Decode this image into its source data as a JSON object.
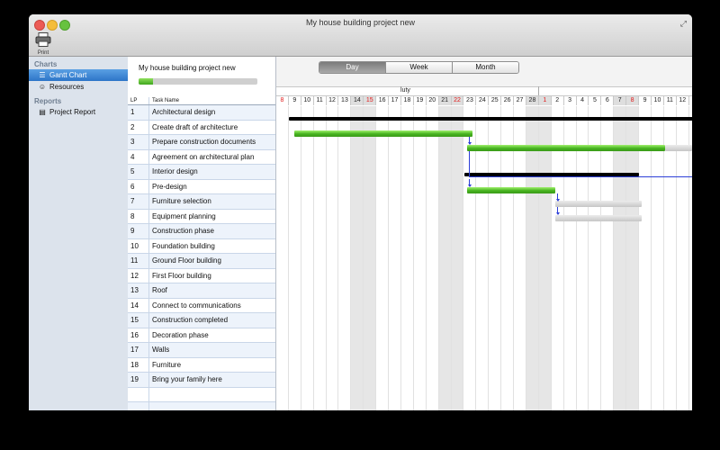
{
  "window": {
    "title": "My house building project new"
  },
  "toolbar": {
    "print_label": "Print"
  },
  "sidebar": {
    "charts_header": "Charts",
    "charts_items": [
      {
        "label": "Gantt Chart",
        "icon": "gantt-icon",
        "selected": true
      },
      {
        "label": "Resources",
        "icon": "people-icon",
        "selected": false
      }
    ],
    "reports_header": "Reports",
    "reports_items": [
      {
        "label": "Project Report",
        "icon": "report-icon",
        "selected": false
      }
    ]
  },
  "project": {
    "name": "My house building project new",
    "progress": 0.12
  },
  "task_table": {
    "col_lp": "LP",
    "col_name": "Task Name",
    "rows": [
      {
        "lp": "1",
        "name": "Architectural design"
      },
      {
        "lp": "2",
        "name": "Create draft of architecture"
      },
      {
        "lp": "3",
        "name": "Prepare construction documents"
      },
      {
        "lp": "4",
        "name": "Agreement on architectural plan"
      },
      {
        "lp": "5",
        "name": "Interior design"
      },
      {
        "lp": "6",
        "name": "Pre-design"
      },
      {
        "lp": "7",
        "name": "Furniture selection"
      },
      {
        "lp": "8",
        "name": "Equipment planning"
      },
      {
        "lp": "9",
        "name": "Construction phase"
      },
      {
        "lp": "10",
        "name": "Foundation building"
      },
      {
        "lp": "11",
        "name": "Ground Floor building"
      },
      {
        "lp": "12",
        "name": "First Floor building"
      },
      {
        "lp": "13",
        "name": "Roof"
      },
      {
        "lp": "14",
        "name": "Connect to communications"
      },
      {
        "lp": "15",
        "name": "Construction completed"
      },
      {
        "lp": "16",
        "name": "Decoration phase"
      },
      {
        "lp": "17",
        "name": "Walls"
      },
      {
        "lp": "18",
        "name": "Furniture"
      },
      {
        "lp": "19",
        "name": "Bring your family here"
      }
    ]
  },
  "gantt": {
    "view_modes": [
      "Day",
      "Week",
      "Month"
    ],
    "active_view": "Day",
    "month_label": "luty",
    "days": [
      "8",
      "9",
      "10",
      "11",
      "12",
      "13",
      "14",
      "15",
      "16",
      "17",
      "18",
      "19",
      "20",
      "21",
      "22",
      "23",
      "24",
      "25",
      "26",
      "27",
      "28",
      "1",
      "2",
      "3",
      "4",
      "5",
      "6",
      "7",
      "8",
      "9",
      "10",
      "11",
      "12"
    ],
    "weekend_days_index": [
      6,
      7,
      13,
      14,
      20,
      21,
      27,
      28
    ],
    "holiday_days_index": [
      0,
      7,
      14,
      21,
      28
    ],
    "colors": {
      "progress_green": "#46b21f",
      "planned_gray": "#c6c6c6",
      "summary": "#000000",
      "dependency": "#2d3fd8"
    }
  }
}
